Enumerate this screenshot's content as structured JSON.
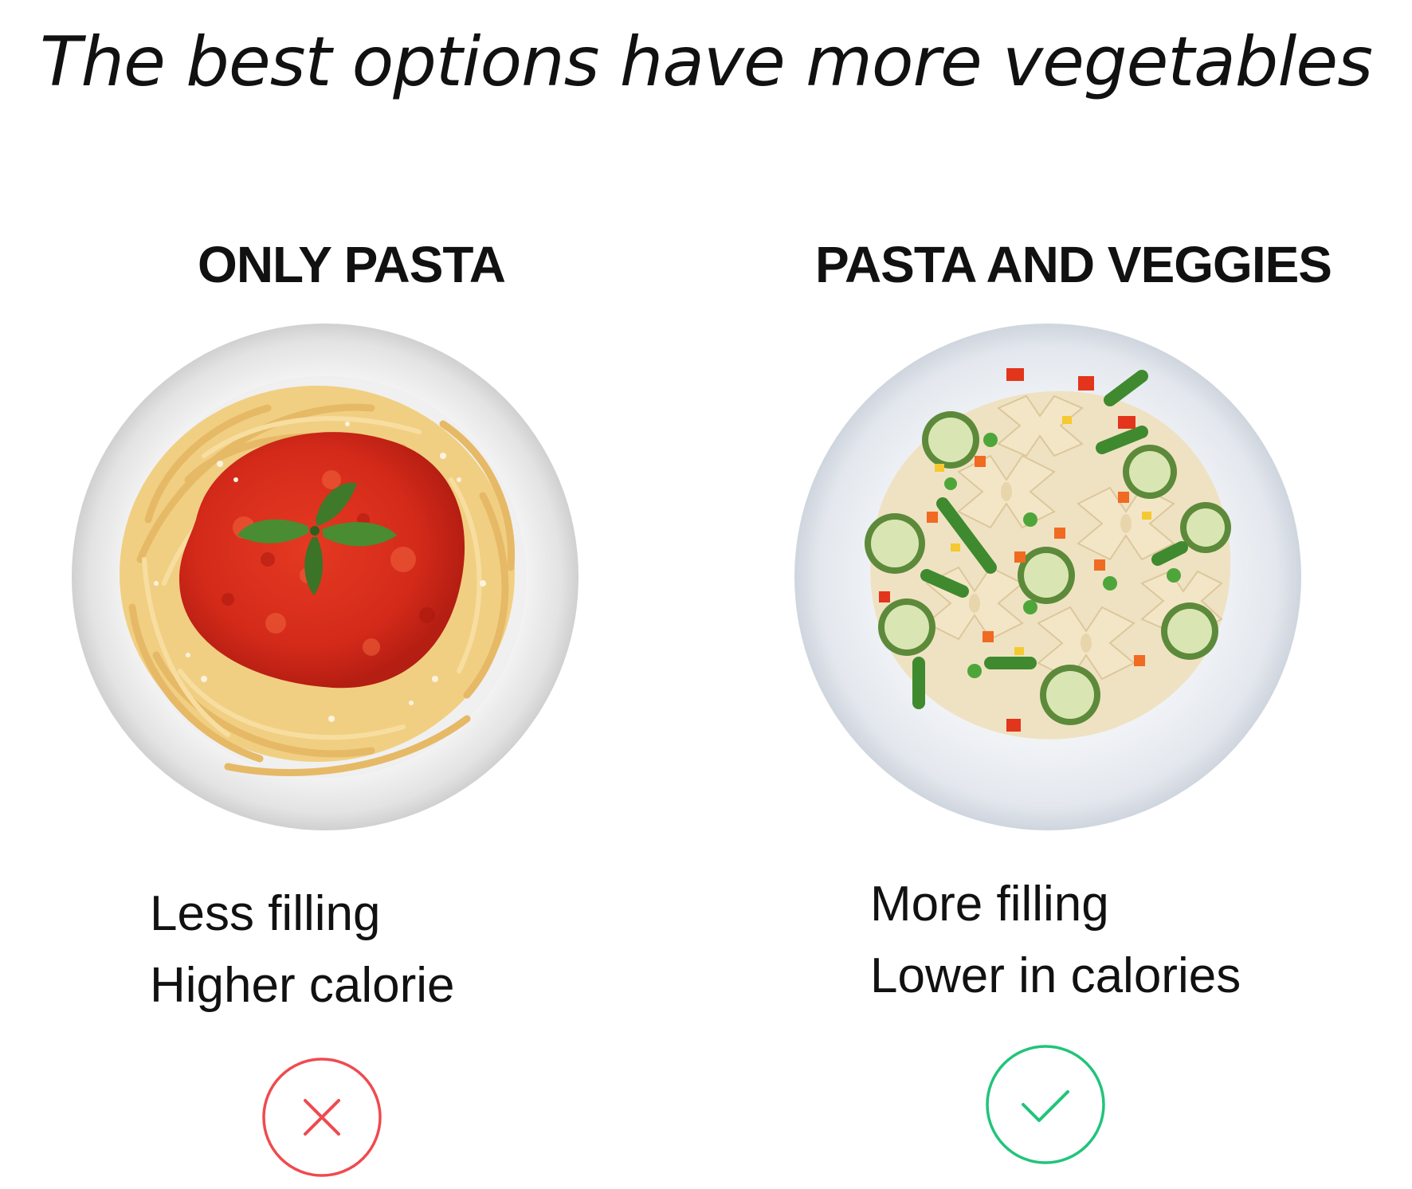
{
  "headline": "The best options have more vegetables",
  "colors": {
    "bad": "#ef4a4f",
    "good": "#21c47a",
    "text": "#111111"
  },
  "comparison": [
    {
      "title": "ONLY PASTA",
      "image": "spaghetti-with-tomato-sauce-plate",
      "benefits": [
        "Less filling",
        "Higher calorie"
      ],
      "verdict": "x-icon"
    },
    {
      "title": "PASTA AND VEGGIES",
      "image": "farfalle-with-vegetables-plate",
      "benefits": [
        "More filling",
        "Lower in calories"
      ],
      "verdict": "check-icon"
    }
  ]
}
